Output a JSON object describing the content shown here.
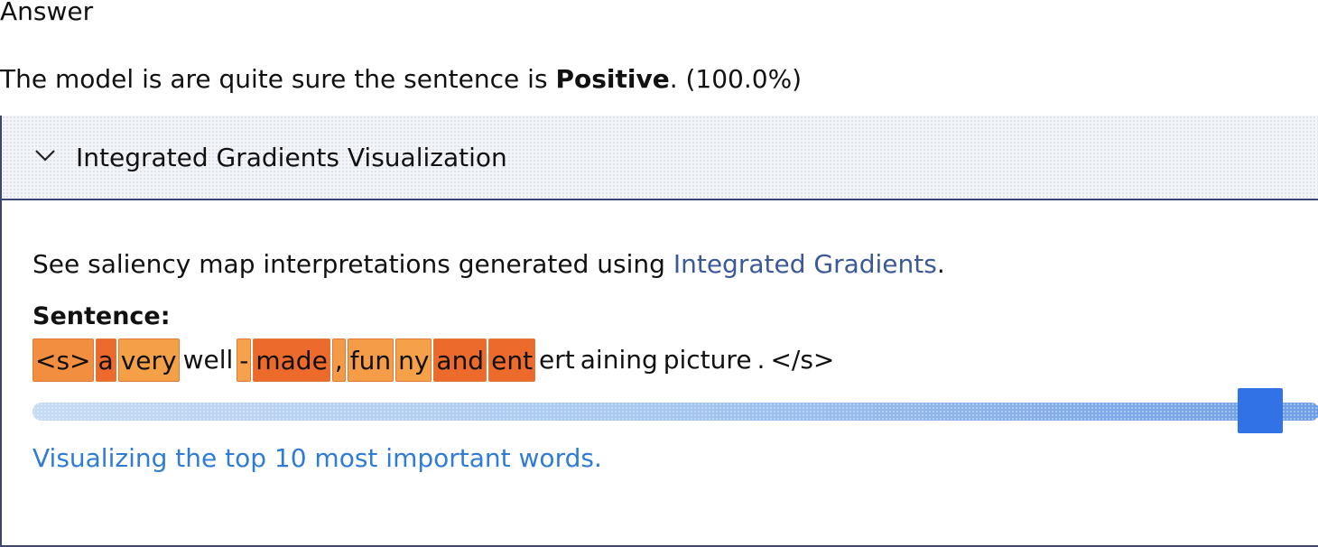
{
  "answer": {
    "heading": "Answer",
    "text_prefix": "The model is are quite sure the sentence is ",
    "label": "Positive",
    "text_suffix": ". (100.0%)"
  },
  "panel": {
    "title": "Integrated Gradients Visualization",
    "expanded": true,
    "chevron_icon": "chevron-down-icon",
    "description_prefix": "See saliency map interpretations generated using ",
    "description_link": "Integrated Gradients",
    "description_suffix": ".",
    "sentence_label": "Sentence:",
    "tokens": [
      {
        "text": "<s>",
        "color": "#f28e3f"
      },
      {
        "text": "a",
        "color": "#ec6b2c"
      },
      {
        "text": "very",
        "color": "#f4a047"
      },
      {
        "text": "well",
        "color": ""
      },
      {
        "text": "-",
        "color": "#f6a24c"
      },
      {
        "text": "made",
        "color": "#ec6a2b"
      },
      {
        "text": ",",
        "color": "#f39a46"
      },
      {
        "text": "fun",
        "color": "#f49c47"
      },
      {
        "text": "ny",
        "color": "#f5a149"
      },
      {
        "text": "and",
        "color": "#ec6a2b"
      },
      {
        "text": "ent",
        "color": "#ec6a2b"
      },
      {
        "text": "ert",
        "color": ""
      },
      {
        "text": "aining",
        "color": ""
      },
      {
        "text": "picture",
        "color": ""
      },
      {
        "text": ".",
        "color": ""
      },
      {
        "text": "</s>",
        "color": ""
      }
    ],
    "slider": {
      "value_fraction": 0.97,
      "thumb_color": "#3172e6"
    },
    "slider_caption": "Visualizing the top 10 most important words."
  },
  "colors": {
    "link": "#3b5898",
    "caption": "#2f7cd6",
    "panel_border": "#3c4670"
  }
}
